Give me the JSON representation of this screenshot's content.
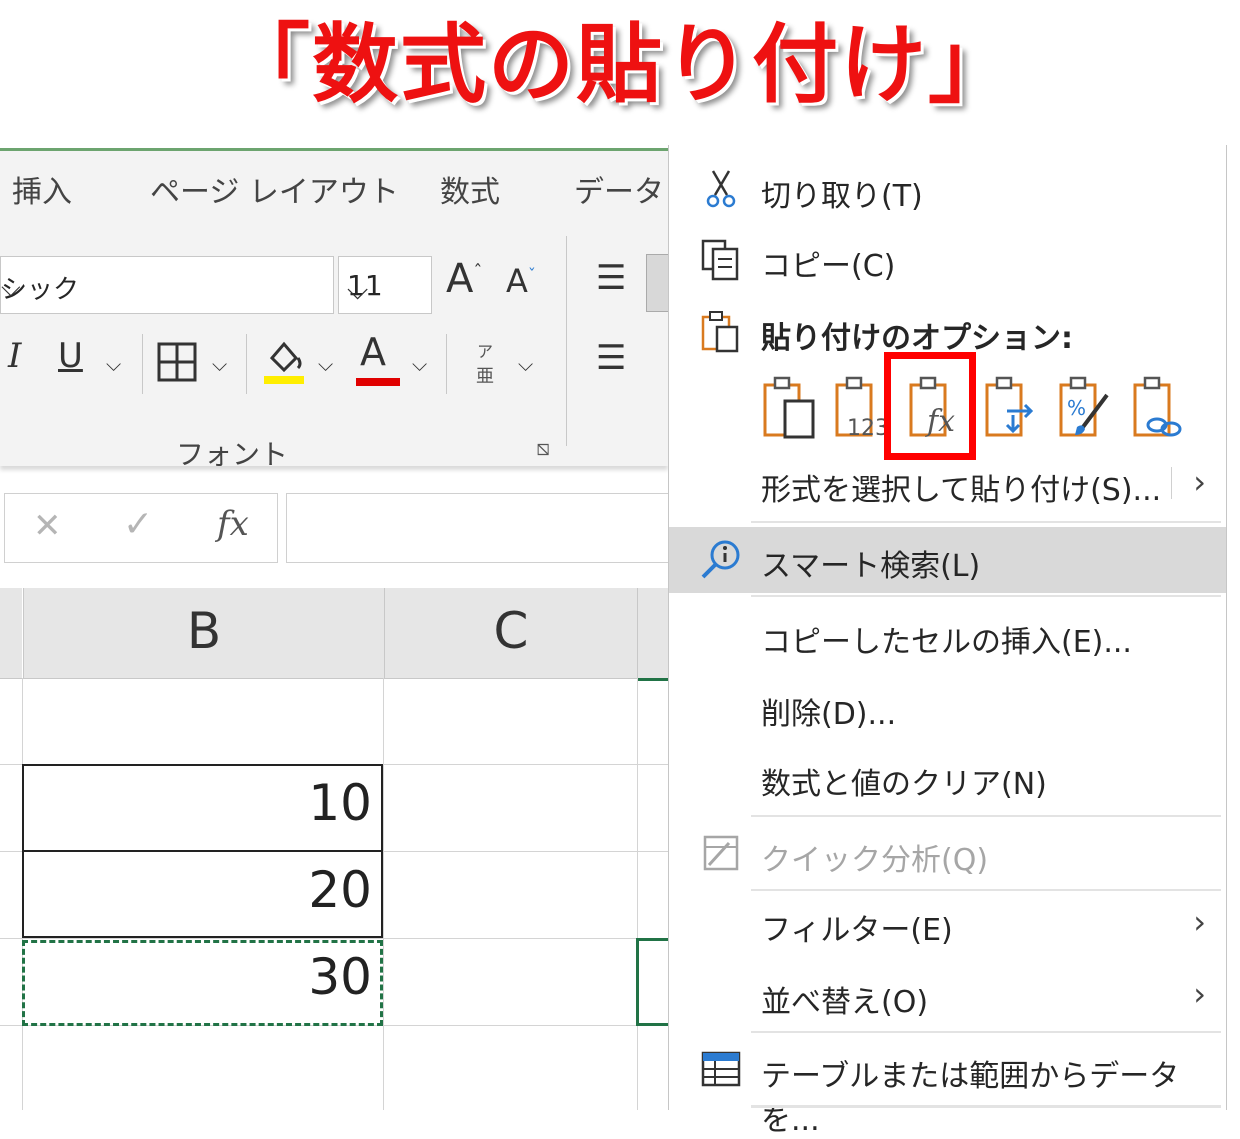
{
  "headline": "「数式の貼り付け」",
  "ribbon": {
    "tabs": [
      "挿入",
      "ページ レイアウト",
      "数式",
      "データ"
    ],
    "font_name": "シック",
    "font_size": "11",
    "grow_font": "A",
    "shrink_font": "A",
    "italic": "I",
    "underline": "U",
    "font_color_letter": "A",
    "phonetic_top": "ア",
    "phonetic_bottom": "亜",
    "group_label": "フォント"
  },
  "formula_bar": {
    "cancel": "✕",
    "enter": "✓",
    "fx": "fx",
    "value": ""
  },
  "sheet": {
    "columns": [
      "B",
      "C"
    ],
    "values": [
      "10",
      "20",
      "30"
    ]
  },
  "context_menu": {
    "cut": "切り取り(T)",
    "copy": "コピー(C)",
    "paste_options": "貼り付けのオプション:",
    "paste_special": "形式を選択して貼り付け(S)...",
    "smart_lookup": "スマート検索(L)",
    "insert_copied": "コピーしたセルの挿入(E)...",
    "delete": "削除(D)...",
    "clear": "数式と値のクリア(N)",
    "quick_analysis": "クイック分析(Q)",
    "filter": "フィルター(E)",
    "sort": "並べ替え(O)",
    "table_range": "テーブルまたは範囲からデータを..."
  },
  "paste_icons": [
    "paste-icon",
    "paste-values-icon",
    "paste-formulas-icon",
    "paste-transpose-icon",
    "paste-formatting-icon",
    "paste-link-icon"
  ],
  "colors": {
    "headline": "#ee1111",
    "highlight_box": "#ff0000",
    "accent_orange": "#d97a1f",
    "fill_yellow": "#ffee00",
    "font_red": "#e00000",
    "selection_green": "#217346"
  }
}
